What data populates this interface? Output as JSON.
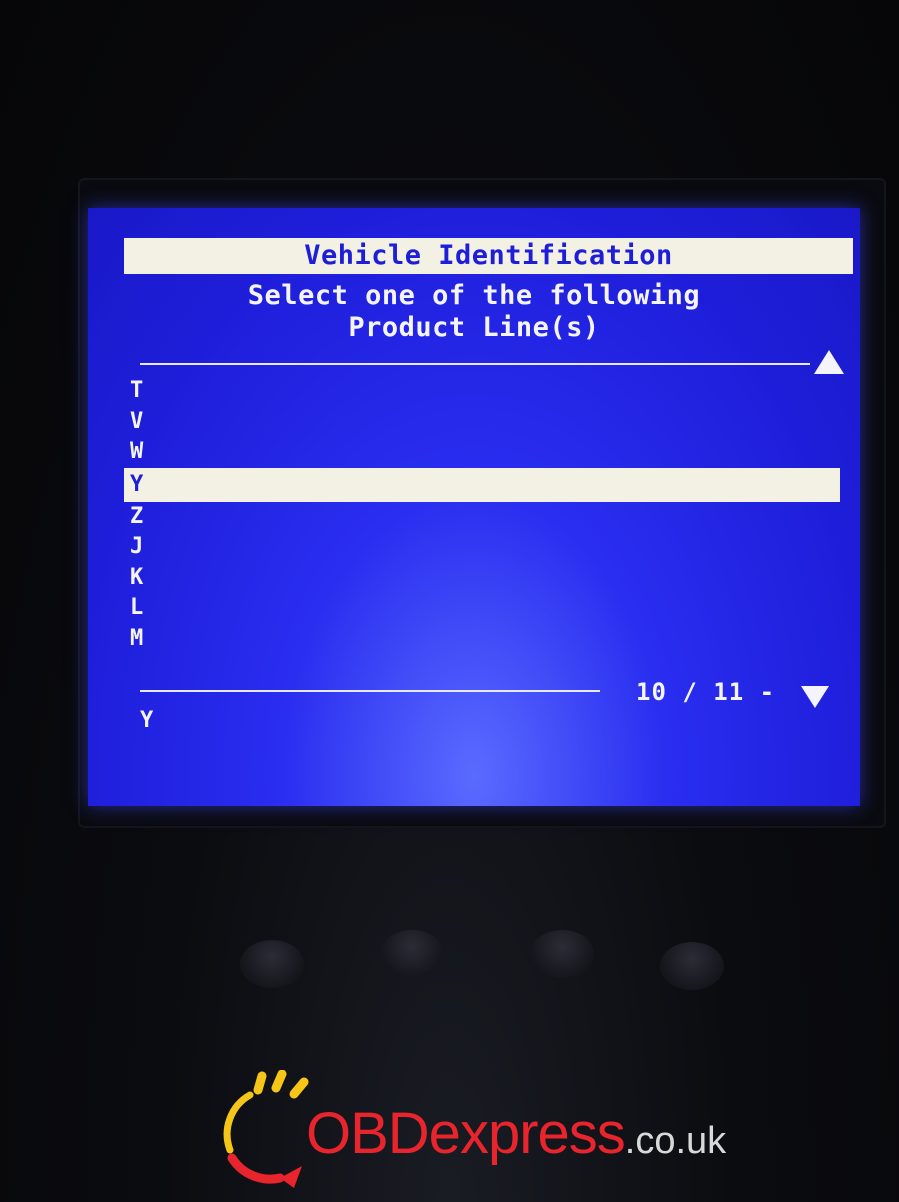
{
  "screen": {
    "title": "Vehicle Identification",
    "subtitle_line1": "Select one of the following",
    "subtitle_line2": "Product Line(s)",
    "items": [
      "T",
      "V",
      "W",
      "Y",
      "Z",
      "J",
      "K",
      "L",
      "M"
    ],
    "selected_index": 3,
    "page_indicator": "10 / 11 -",
    "current_selection": "Y"
  },
  "icons": {
    "scroll_up": "triangle-up-icon",
    "scroll_down": "triangle-down-icon"
  },
  "watermark": {
    "brand": "OBDexpress",
    "tld": ".co.uk"
  },
  "colors": {
    "screen_blue": "#1f1fdc",
    "highlight": "#f3f1e3",
    "logo_red": "#e8242c",
    "logo_yellow": "#f5c518"
  }
}
